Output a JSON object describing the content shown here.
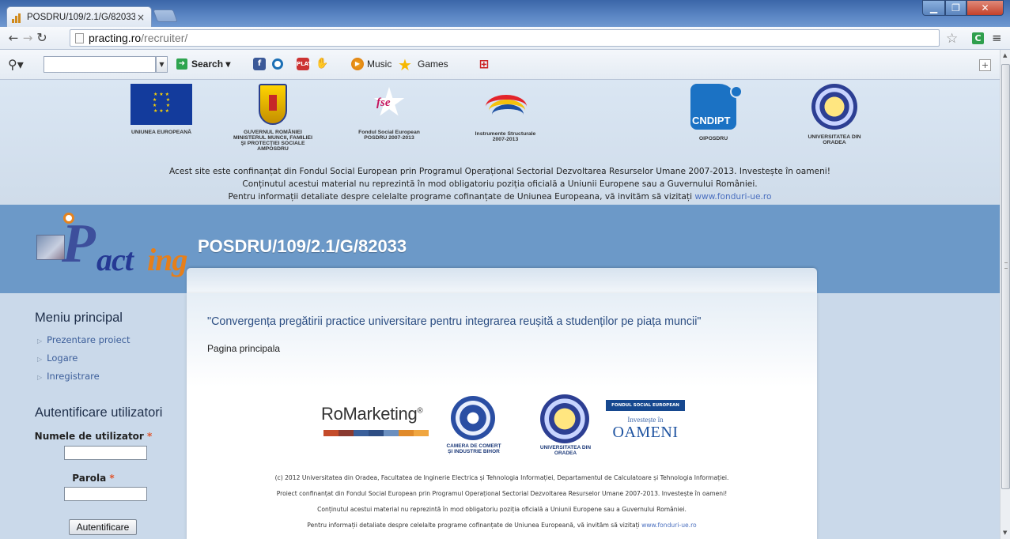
{
  "browser": {
    "tab_title": "POSDRU/109/2.1/G/82033",
    "tab_close": "×",
    "url_host": "practing.ro",
    "url_path": "/recruiter/",
    "win_min": "▁",
    "win_max": "❐",
    "win_close": "✕"
  },
  "toolbar": {
    "search_label": "Search ▾",
    "music_label": "Music",
    "games_label": "Games",
    "fb_glyph": "f",
    "play_glyph": "PLAY",
    "ext_glyph": "C"
  },
  "funders": {
    "logos": [
      {
        "label": "UNIUNEA EUROPEANĂ"
      },
      {
        "label": "GUVERNUL ROMÂNIEI\nMINISTERUL MUNCII, FAMILIEI\nŞI PROTECŢIEI SOCIALE\nAMPOSDRU"
      },
      {
        "label": "Fondul Social European\nPOSDRU 2007-2013"
      },
      {
        "label": "Instrumente Structurale\n2007-2013"
      },
      {
        "label": "OIPOSDRU"
      },
      {
        "label": "UNIVERSITATEA DIN\nORADEA"
      }
    ],
    "fse_logo_text": "fse",
    "cnd_text": "CNDIPT",
    "line1": "Acest site este confinanțat din Fondul Social European prin Programul Operațional Sectorial Dezvoltarea Resurselor Umane 2007-2013. Investește în oameni!",
    "line2": "Conținutul acestui material nu reprezintă în mod obligatoriu poziția oficială a Uniunii Europene sau a Guvernului României.",
    "line3_prefix": "Pentru informații detaliate despre celelalte programe cofinanțate de Uniunea Europeana, vă invităm să vizitați ",
    "line3_link": "www.fonduri-ue.ro"
  },
  "header": {
    "logo_p": "P",
    "logo_act": "act",
    "logo_ing": "ing",
    "project_code": "POSDRU/109/2.1/G/82033"
  },
  "sidebar": {
    "menu_title": "Meniu principal",
    "menu_items": [
      {
        "label": "Prezentare proiect"
      },
      {
        "label": "Logare"
      },
      {
        "label": "Inregistrare"
      }
    ],
    "auth_title": "Autentificare utilizatori",
    "username_label": "Numele de utilizator",
    "password_label": "Parola",
    "required_mark": "*",
    "login_button": "Autentificare"
  },
  "content": {
    "quote": "\"Convergența pregătirii practice universitare pentru integrarea reușită a studenților pe piața muncii\"",
    "breadcrumb": "Pagina principala",
    "sponsors": {
      "romarketing": "RoMarketing",
      "romarketing_reg": "®",
      "romarketing_colors": [
        "#c44b2a",
        "#8a3a30",
        "#3a5f9a",
        "#2e4e84",
        "#6b8fbf",
        "#e08a2a",
        "#f0a640"
      ],
      "cc_label": "CAMERA DE COMERȚ\nȘI INDUSTRIE BIHOR",
      "uo_label": "UNIVERSITATEA DIN\nORADEA",
      "fse_banner": "FONDUL SOCIAL EUROPEAN",
      "fse_sub": "Investește în",
      "fse_big": "OAMENI"
    },
    "footer_lines": [
      "(c) 2012 Universitatea din Oradea, Facultatea de Inginerie Electrica și Tehnologia Informației, Departamentul de Calculatoare și Tehnologia Informației.",
      "Proiect confinanțat din Fondul Social European prin Programul Operațional Sectorial Dezvoltarea Resurselor Umane 2007-2013. Investește în oameni!",
      "Conținutul acestui material nu reprezintă în mod obligatoriu poziția oficială a Uniunii Europene sau a Guvernului României."
    ],
    "footer_last_prefix": "Pentru informații detaliate despre celelalte programe cofinanțate de Uniunea Europeană, vă invităm să vizitați ",
    "footer_last_link": "www.fonduri-ue.ro"
  },
  "colors": {
    "header_band": "#6c99c8",
    "page_bg": "#cad9ea",
    "link": "#3d5f9a",
    "required": "#e0542b",
    "logo_orange": "#e67f1a",
    "logo_blue": "#253994"
  }
}
